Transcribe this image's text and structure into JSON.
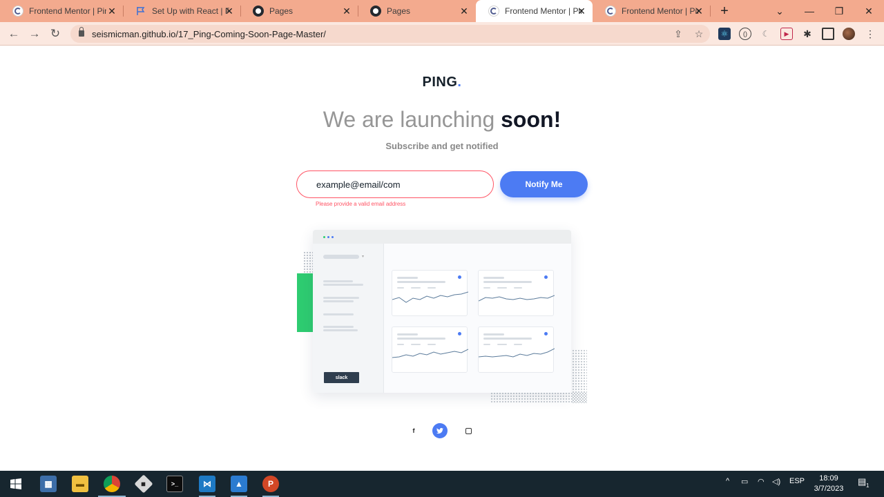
{
  "browser": {
    "tabs": [
      {
        "title": "Frontend Mentor | Ping",
        "icon": "frontend-mentor-icon"
      },
      {
        "title": "Set Up with React | Fo",
        "icon": "flag-icon"
      },
      {
        "title": "Pages",
        "icon": "github-icon"
      },
      {
        "title": "Pages",
        "icon": "github-icon"
      },
      {
        "title": "Frontend Mentor | Ping",
        "icon": "frontend-mentor-icon",
        "active": true
      },
      {
        "title": "Frontend Mentor | Ping",
        "icon": "frontend-mentor-icon"
      }
    ],
    "url": "seismicman.github.io/17_Ping-Coming-Soon-Page-Master/",
    "colors": {
      "frame": "#f3aa8e",
      "toolbar": "#fbe8e0"
    }
  },
  "page": {
    "logo": "PING",
    "logo_dot": ".",
    "headline_light": "We are launching",
    "headline_bold": "soon!",
    "subtitle": "Subscribe and get notified",
    "email_value": "example@email/com",
    "error": "Please provide a valid email address",
    "button": "Notify Me",
    "slack_label": "slack",
    "social": [
      "facebook-icon",
      "twitter-icon",
      "instagram-icon"
    ],
    "colors": {
      "accent": "#4c7bf3",
      "error": "#ff5263",
      "green": "#2ecc71"
    }
  },
  "taskbar": {
    "language": "ESP",
    "time": "18:09",
    "date": "3/7/2023",
    "notification_count": "1"
  }
}
